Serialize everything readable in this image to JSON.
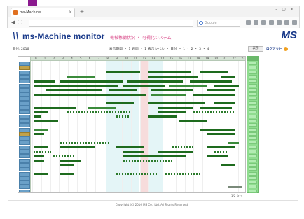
{
  "browser": {
    "tab_title": "ms-Machine",
    "url": "",
    "search_placeholder": "Google"
  },
  "app": {
    "title": "ms-Machine monitor",
    "subtitle": "機械稼働状況 ・ 可視化システム",
    "brand": "MS",
    "info_left": "日付: 2016",
    "info_mid": "表示期間 ・ 1 週間 ・ 1 表示レベル ・ 日付 ・ 1 ・ 2 ・ 3 ・ 4",
    "display_button": "表示",
    "login_label": "ログアウト"
  },
  "grid": {
    "hours": [
      "0",
      "1",
      "2",
      "3",
      "4",
      "5",
      "6",
      "7",
      "8",
      "9",
      "10",
      "11",
      "12",
      "13",
      "14",
      "15",
      "16",
      "17",
      "18",
      "19",
      "20",
      "21",
      "22",
      "23"
    ],
    "machine_count": 30,
    "highlighted_machines": [
      1,
      16
    ]
  },
  "pager": "1/2 次へ",
  "footer": "Copyright (C) 2016 MS Co., Ltd. All Rights Reserved."
}
